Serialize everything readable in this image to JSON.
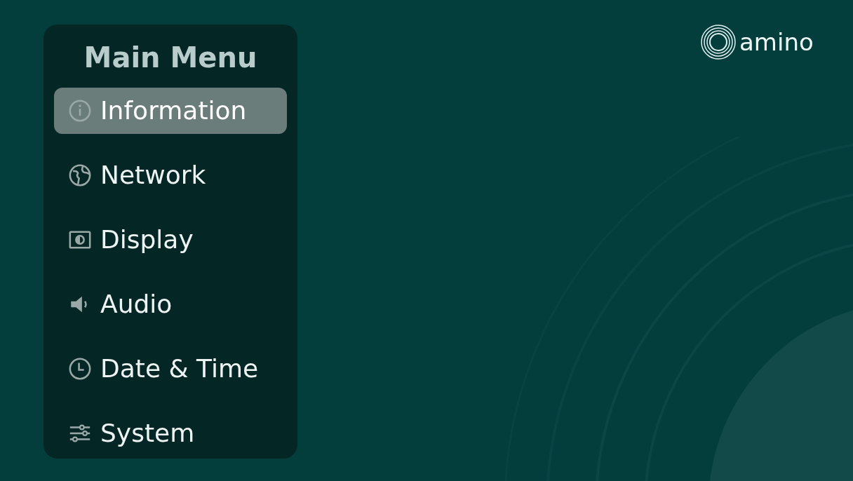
{
  "logo": {
    "text": "amino"
  },
  "menu": {
    "title": "Main Menu",
    "items": [
      {
        "label": "Information",
        "selected": true
      },
      {
        "label": "Network",
        "selected": false
      },
      {
        "label": "Display",
        "selected": false
      },
      {
        "label": "Audio",
        "selected": false
      },
      {
        "label": "Date & Time",
        "selected": false
      },
      {
        "label": "System",
        "selected": false
      }
    ]
  }
}
